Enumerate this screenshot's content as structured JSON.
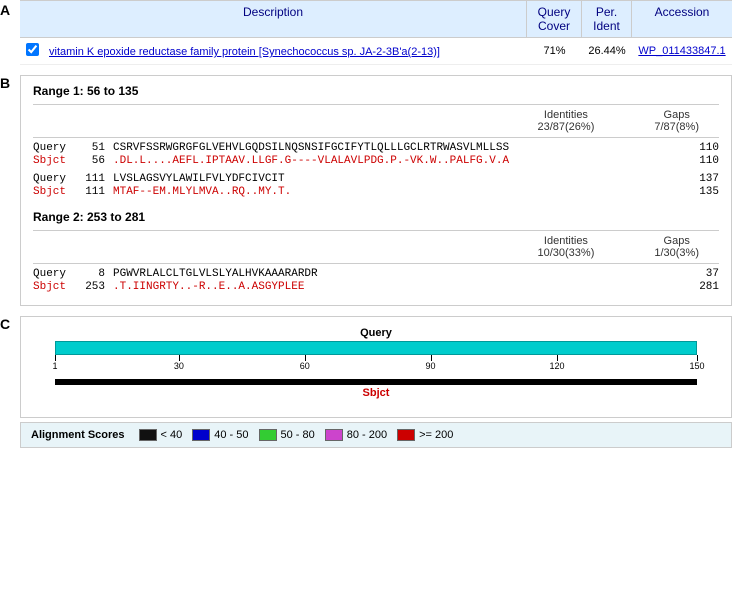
{
  "sections": {
    "a": {
      "label": "A",
      "table": {
        "headers": {
          "description": "Description",
          "query_cover": "Query Cover",
          "per_ident": "Per. Ident",
          "accession": "Accession"
        },
        "rows": [
          {
            "checked": true,
            "description": "vitamin K epoxide reductase family protein [Synechococcus sp. JA-2-3B'a(2-13)]",
            "query_cover": "71%",
            "per_ident": "26.44%",
            "accession": "WP_011433847.1"
          }
        ]
      }
    },
    "b": {
      "label": "B",
      "ranges": [
        {
          "title": "Range 1: 56 to 135",
          "identities_label": "Identities",
          "identities_value": "23/87(26%)",
          "gaps_label": "Gaps",
          "gaps_value": "7/87(8%)",
          "alignments": [
            {
              "type": "query",
              "label": "Query",
              "start": "51",
              "seq": "CSRVFSSRWGRGFGLVEHVLGQDSILNQSNSIFGCIFYTLQLLLGCLRTRWASVLMLLSS",
              "end": "110"
            },
            {
              "type": "sbjct",
              "label": "Sbjct",
              "start": "56",
              "seq": ".DL.L....AEFL.IPTAAV.LLGF.G----VLALAVLPDG.P.-VK.W..PALFG.V.A",
              "end": "110"
            },
            {
              "type": "query",
              "label": "Query",
              "start": "111",
              "seq": "LVSLAGSVYLAWILFVLYDFCIVCIT",
              "end": "137"
            },
            {
              "type": "sbjct",
              "label": "Sbjct",
              "start": "111",
              "seq": "MTAF--EM.MLYLMVA..RQ..MY.T.",
              "end": "135"
            }
          ]
        },
        {
          "title": "Range 2: 253 to 281",
          "identities_label": "Identities",
          "identities_value": "10/30(33%)",
          "gaps_label": "Gaps",
          "gaps_value": "1/30(3%)",
          "alignments": [
            {
              "type": "query",
              "label": "Query",
              "start": "8",
              "seq": "PGWVRLALCLTGLVLSLYALHVKAAARARDR",
              "end": "37"
            },
            {
              "type": "sbjct",
              "label": "Sbjct",
              "start": "253",
              "seq": ".T.IINGRTY..-R..E..A.ASGYPLEE",
              "end": "281"
            }
          ]
        }
      ]
    },
    "c": {
      "label": "C",
      "query_label": "Query",
      "sbjct_label": "Sbjct",
      "scale": {
        "marks": [
          1,
          30,
          60,
          90,
          120,
          150
        ]
      },
      "legend": {
        "title": "Alignment Scores",
        "items": [
          {
            "label": "< 40",
            "color": "#111111"
          },
          {
            "label": "40 - 50",
            "color": "#0000cc"
          },
          {
            "label": "50 - 80",
            "color": "#33cc33"
          },
          {
            "label": "80 - 200",
            "color": "#cc44cc"
          },
          {
            "label": ">= 200",
            "color": "#cc0000"
          }
        ]
      }
    }
  }
}
